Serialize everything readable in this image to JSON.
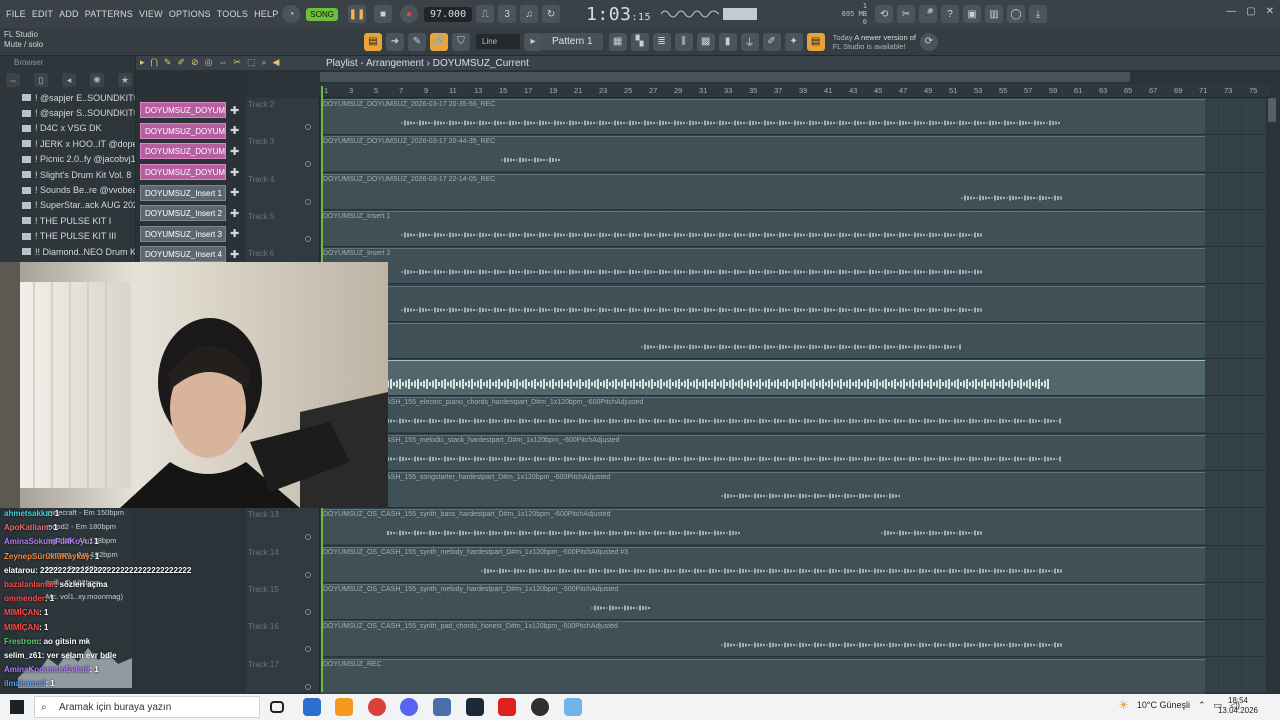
{
  "menu": [
    "FILE",
    "EDIT",
    "ADD",
    "PATTERNS",
    "VIEW",
    "OPTIONS",
    "TOOLS",
    "HELP"
  ],
  "transport": {
    "mode": "SONG",
    "tempo": "97.000",
    "time_main": "1:03",
    "time_sub": ":15"
  },
  "cpu": {
    "mem": "695 MB",
    "line1": "1",
    "line2": "0"
  },
  "hint": {
    "title": "FL Studio",
    "sub": "Mute / solo"
  },
  "toolbar2": {
    "snap": "Line",
    "pattern": "Pattern 1"
  },
  "news": {
    "date": "Today",
    "text": "A newer version of",
    "text2": "FL Studio is available!"
  },
  "browser": {
    "title": "Browser",
    "items": [
      "! @sapjer E..SOUNDKIT®",
      "! @sapjer S..SOUNDKIT®",
      "! D4C x VSG DK",
      "! JERK x HOO..IT @dopekit",
      "! Picnic 2.0..fy @jacobvj1)",
      "! Slight's Drum Kit Vol. 8",
      "! Sounds Be..re @vvobeats",
      "! SuperStar..ack AUG 2020",
      "! THE PULSE KIT I",
      "! THE PULSE KIT III",
      "!! Diamond..NEO Drum Kit"
    ]
  },
  "channels": [
    {
      "name": "DOYUMSUZ_DOYUMSU..",
      "type": "audio"
    },
    {
      "name": "DOYUMSUZ_DOYUMSU..",
      "type": "audio"
    },
    {
      "name": "DOYUMSUZ_DOYUMSU..",
      "type": "audio"
    },
    {
      "name": "DOYUMSUZ_DOYUMSU..",
      "type": "audio"
    },
    {
      "name": "DOYUMSUZ_Insert 1",
      "type": "insert"
    },
    {
      "name": "DOYUMSUZ_Insert 2",
      "type": "insert"
    },
    {
      "name": "DOYUMSUZ_Insert 3",
      "type": "insert"
    },
    {
      "name": "DOYUMSUZ_Insert 4",
      "type": "insert"
    }
  ],
  "playlist": {
    "title": "Playlist - Arrangement",
    "breadcrumb": "DOYUMSUZ_Current",
    "ticks": [
      "1",
      "3",
      "5",
      "7",
      "9",
      "11",
      "13",
      "15",
      "17",
      "19",
      "21",
      "23",
      "25",
      "27",
      "29",
      "31",
      "33",
      "35",
      "37",
      "39",
      "41",
      "43",
      "45",
      "47",
      "49",
      "51",
      "53",
      "55",
      "57",
      "59",
      "61",
      "63",
      "65",
      "67",
      "69",
      "71",
      "73",
      "75"
    ],
    "tracks": [
      "Track 2",
      "Track 3",
      "Track 4",
      "Track 5",
      "Track 6",
      "Track 7",
      "Track 8",
      "Track 9",
      "Track 10",
      "Track 11",
      "Track 12",
      "Track 13",
      "Track 14",
      "Track 15",
      "Track 16",
      "Track 17"
    ],
    "clips": [
      "DOYUMSUZ_DOYUMSUZ_2026-03-17 20-35-56_REC",
      "DOYUMSUZ_DOYUMSUZ_2026-03-17 20-44-35_REC",
      "DOYUMSUZ_DOYUMSUZ_2026-03-17 22-14-05_REC",
      "DOYUMSUZ_Insert 1",
      "DOYUMSUZ_Insert 2",
      "",
      "",
      "",
      "DOYUMSUZ_OS_CASH_155_electric_piano_chords_hardestpart_D#m_1x120bpm_-600PitchAdjusted",
      "DOYUMSUZ_OS_CASH_155_melodic_stack_hardestpart_D#m_1x120bpm_-600PitchAdjusted",
      "DOYUMSUZ_OS_CASH_155_songstarter_hardestpart_D#m_1x120bpm_-600PitchAdjusted",
      "DOYUMSUZ_OS_CASH_155_synth_bass_hardestpart_D#m_1x120bpm_-600PitchAdjusted",
      "DOYUMSUZ_OS_CASH_155_synth_melody_hardestpart_D#m_1x120bpm_-600PitchAdjusted #3",
      "DOYUMSUZ_OS_CASH_155_synth_melody_hardestpart_D#m_1x120bpm_-600PitchAdjusted",
      "DOYUMSUZ_OS_CASH_155_synth_pad_chords_honest_D#m_1x120bpm_-600PitchAdjusted",
      "DOYUMSUZ_REC"
    ]
  },
  "mini_browser": [
    "minecraft - Em 150bpm",
    "mood2 - Em 180bpm",
    "nightfall - Ab 178bpm",
    "nonono - Am 192bpm",
    "toxic - Fm 160bpm",
    "twifi - D 182bpm",
    "Mc. vol1..xy.moonmag)"
  ],
  "chat": [
    {
      "user": "ahmetsakka",
      "msg": ": 1",
      "color": "#3fd3d8"
    },
    {
      "user": "ApoKatliam",
      "msg": ": 1",
      "color": "#e86a6a"
    },
    {
      "user": "AminaSokumFullKoyu",
      "msg": ": 1",
      "color": "#b07cf4"
    },
    {
      "user": "ZeynepSürüklüKaykay",
      "msg": ": 1",
      "color": "#f08a3c"
    },
    {
      "user": "elatarou",
      "msg": ": 2222222222222222222222222222222222",
      "color": "#ffffff"
    },
    {
      "user": "bazalanlamar",
      "msg": ": sözleri açma",
      "color": "#ff4a4a"
    },
    {
      "user": "ommender",
      "msg": ": 1",
      "color": "#ff4a4a"
    },
    {
      "user": "MIMİÇAN",
      "msg": ": 1",
      "color": "#ff4a4a"
    },
    {
      "user": "MIMİÇAN",
      "msg": ": 1",
      "color": "#ff4a4a"
    },
    {
      "user": "Frestrom",
      "msg": ": ao gitsin mk",
      "color": "#55d36a"
    },
    {
      "user": "selim_z61",
      "msg": ": ver selam evr bdle",
      "color": "#ffffff"
    },
    {
      "user": "AminaKodumunEvladi",
      "msg": ": 1",
      "color": "#b07cf4"
    },
    {
      "user": "ilmahamail",
      "msg": ": 1",
      "color": "#5a9cf0"
    }
  ],
  "taskbar": {
    "search_placeholder": "Aramak için buraya yazın",
    "weather": "10°C Güneşli",
    "time": "18:54",
    "date": "13.04.2026"
  }
}
